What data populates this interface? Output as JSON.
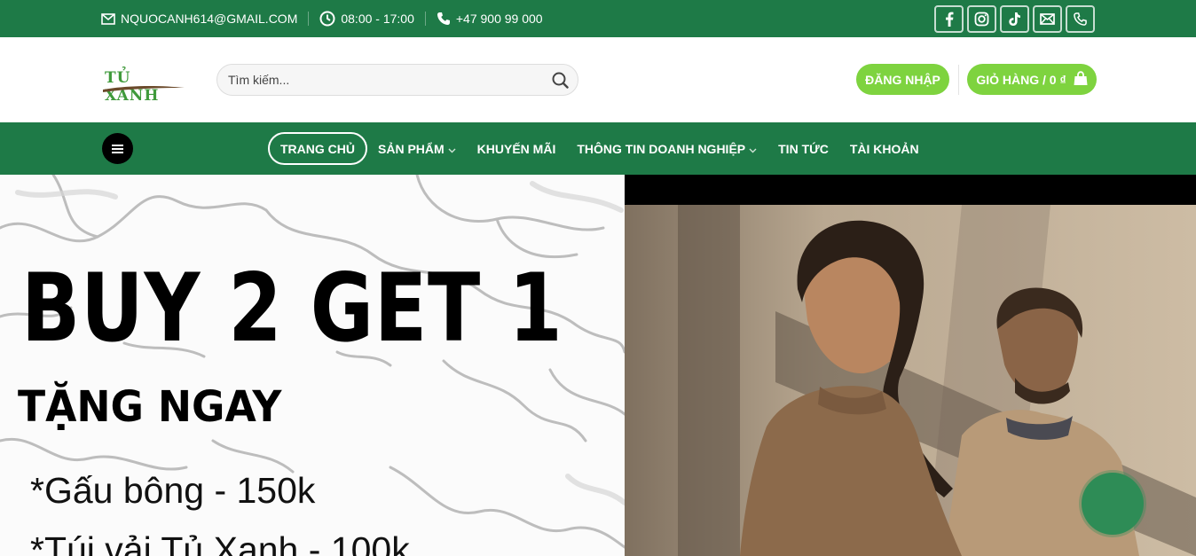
{
  "topbar": {
    "email": "NQUOCANH614@GMAIL.COM",
    "hours": "08:00 - 17:00",
    "phone": "+47 900 99 000",
    "socials": [
      "facebook-icon",
      "instagram-icon",
      "tiktok-icon",
      "envelope-icon",
      "phone-icon"
    ]
  },
  "header": {
    "logo_text": "TỦ XANH",
    "search_placeholder": "Tìm kiếm...",
    "login_label": "ĐĂNG NHẬP",
    "cart_label": "GIỎ HÀNG / 0 ₫"
  },
  "nav": {
    "items": [
      {
        "label": "TRANG CHỦ",
        "active": true
      },
      {
        "label": "SẢN PHẨM",
        "dropdown": true
      },
      {
        "label": "KHUYẾN MÃI"
      },
      {
        "label": "THÔNG TIN DOANH NGHIỆP",
        "dropdown": true
      },
      {
        "label": "TIN TỨC"
      },
      {
        "label": "TÀI KHOẢN"
      }
    ]
  },
  "hero": {
    "title": "BUY 2 GET 1",
    "subtitle": "TẶNG NGAY",
    "lines": [
      "*Gấu bông - 150k",
      "*Túi vải Tủ Xanh - 100k"
    ]
  },
  "colors": {
    "primary_green": "#1e7a47",
    "accent_green": "#7ed33f",
    "chat_green": "#2e8c56"
  }
}
